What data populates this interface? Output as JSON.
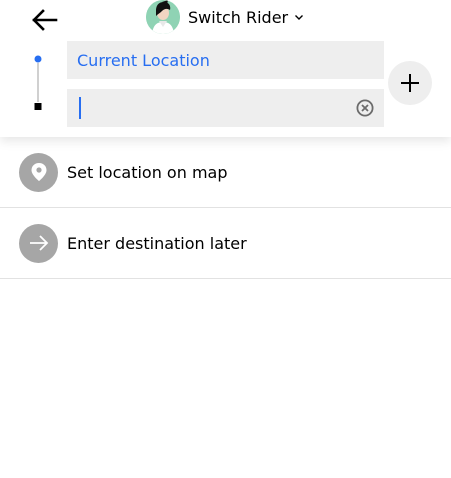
{
  "header": {
    "rider_label": "Switch Rider"
  },
  "trip": {
    "pickup_value": "Current Location",
    "destination_value": "",
    "destination_placeholder": ""
  },
  "suggestions": [
    {
      "label": "Set location on map",
      "icon": "map-pin-icon"
    },
    {
      "label": "Enter destination later",
      "icon": "arrow-right-icon"
    }
  ],
  "colors": {
    "accent": "#276ef1",
    "field_bg": "#eeeeee",
    "icon_circle": "#a6a6a6",
    "avatar_bg": "#8fd3b4"
  }
}
